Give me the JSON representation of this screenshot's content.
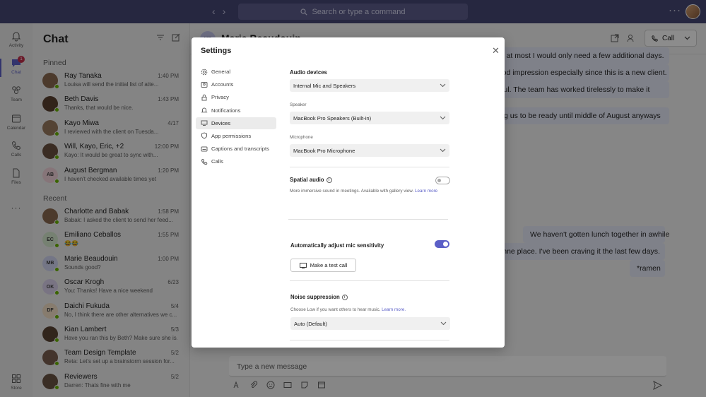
{
  "topbar": {
    "search_placeholder": "Search or type a command",
    "more": "···"
  },
  "rail": [
    {
      "label": "Activity",
      "icon": "bell-icon"
    },
    {
      "label": "Chat",
      "icon": "chat-icon",
      "badge": "1"
    },
    {
      "label": "Team",
      "icon": "team-icon"
    },
    {
      "label": "Calendar",
      "icon": "calendar-icon"
    },
    {
      "label": "Calls",
      "icon": "phone-icon"
    },
    {
      "label": "Files",
      "icon": "file-icon"
    },
    {
      "label": "···",
      "icon": "more-icon"
    },
    {
      "label": "Store",
      "icon": "store-icon"
    }
  ],
  "chatlist": {
    "title": "Chat",
    "pinned_label": "Pinned",
    "recent_label": "Recent",
    "pinned": [
      {
        "name": "Ray Tanaka",
        "time": "1:40 PM",
        "preview": "Louisa will send the initial list of atte...",
        "initials": "",
        "color": "#8a6a50"
      },
      {
        "name": "Beth Davis",
        "time": "1:43 PM",
        "preview": "Thanks, that would be nice.",
        "initials": "",
        "color": "#5a4030"
      },
      {
        "name": "Kayo Miwa",
        "time": "4/17",
        "preview": "I reviewed with the client on Tuesda...",
        "initials": "",
        "color": "#9a7a60"
      },
      {
        "name": "Will, Kayo, Eric, +2",
        "time": "12:00 PM",
        "preview": "Kayo: It would be great to sync with...",
        "initials": "",
        "color": "#6a5040"
      },
      {
        "name": "August Bergman",
        "time": "1:20 PM",
        "preview": "I haven't checked available times yet",
        "initials": "AB",
        "color": "#f4d6dc"
      }
    ],
    "recent": [
      {
        "name": "Charlotte and Babak",
        "time": "1:58 PM",
        "preview": "Babak: I asked the client to send her feed...",
        "initials": "",
        "color": "#8a6a50"
      },
      {
        "name": "Emiliano Ceballos",
        "time": "1:55 PM",
        "preview": "😂😂",
        "initials": "EC",
        "color": "#d8ecd0"
      },
      {
        "name": "Marie Beaudouin",
        "time": "1:00 PM",
        "preview": "Sounds good?",
        "initials": "MB",
        "color": "#d4d8f4"
      },
      {
        "name": "Oscar Krogh",
        "time": "6/23",
        "preview": "You: Thanks! Have a nice weekend",
        "initials": "OK",
        "color": "#dcd4ee"
      },
      {
        "name": "Daichi Fukuda",
        "time": "5/4",
        "preview": "No, I think there are other alternatives we c...",
        "initials": "DF",
        "color": "#f6e2c8"
      },
      {
        "name": "Kian Lambert",
        "time": "5/3",
        "preview": "Have you ran this by Beth? Make sure she is...",
        "initials": "",
        "color": "#5a4434"
      },
      {
        "name": "Team Design Template",
        "time": "5/2",
        "preview": "Reta: Let's set up a brainstorm session for...",
        "initials": "",
        "color": "#7a6050"
      },
      {
        "name": "Reviewers",
        "time": "5/2",
        "preview": "Darren: Thats fine with me",
        "initials": "",
        "color": "#6a5444"
      }
    ]
  },
  "main": {
    "header_initials": "MB",
    "header_name": "Marie Beaudouin",
    "call_label": "Call",
    "messages": [
      "out at most I would only need a few additional days.",
      "good impression especially since this is a new client.",
      "ssful. The team has worked tirelessly to make it",
      "tting us to be ready until middle of August anyways",
      "We haven't gotten lunch together in awhile",
      "ramne place. I've been craving it the last few days.",
      "*ramen"
    ],
    "composer_placeholder": "Type a new message"
  },
  "settings": {
    "title": "Settings",
    "nav": [
      {
        "label": "General",
        "icon": "gear-icon"
      },
      {
        "label": "Accounts",
        "icon": "accounts-icon"
      },
      {
        "label": "Privacy",
        "icon": "lock-icon"
      },
      {
        "label": "Notifications",
        "icon": "bell-icon"
      },
      {
        "label": "Devices",
        "icon": "devices-icon"
      },
      {
        "label": "App permissions",
        "icon": "shield-icon"
      },
      {
        "label": "Captions and transcripts",
        "icon": "captions-icon"
      },
      {
        "label": "Calls",
        "icon": "phone-icon"
      }
    ],
    "active_nav": "Devices",
    "audio_devices_label": "Audio devices",
    "audio_devices_value": "Internal Mic and Speakers",
    "speaker_label": "Speaker",
    "speaker_value": "MacBook Pro Speakers (Built-in)",
    "microphone_label": "Microphone",
    "microphone_value": "MacBook Pro Microphone",
    "spatial_label": "Spatial audio",
    "spatial_desc": "More immersive sound in meetings. Available with gallery view.",
    "spatial_link": "Learn more",
    "spatial_enabled": false,
    "auto_mic_label": "Automatically adjust mic sensitivity",
    "auto_mic_enabled": true,
    "test_call_label": "Make a test call",
    "noise_label": "Noise suppression",
    "noise_desc": "Choose Low if you want others to hear music.",
    "noise_link": "Learn more.",
    "noise_value": "Auto (Default)"
  }
}
